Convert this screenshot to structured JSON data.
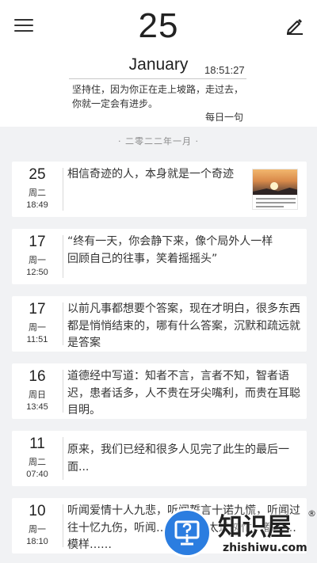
{
  "header": {
    "menu_icon": "hamburger-menu-icon",
    "edit_icon": "pencil-edit-icon",
    "day": "25",
    "month": "January",
    "time": "18:51:27",
    "quote": "坚持住，因为你正在走上坡路，走过去，你就一定会有进步。",
    "quote_label": "每日一句"
  },
  "month_divider": "· 二零二二年一月 ·",
  "entries": [
    {
      "day": "25",
      "weekday": "周二",
      "time": "18:49",
      "text": "相信奇迹的人，本身就是一个奇迹"
    },
    {
      "day": "17",
      "weekday": "周一",
      "time": "12:50",
      "text": "“终有一天，你会静下来，像个局外人一样回顾自己的往事，笑着摇摇头”"
    },
    {
      "day": "17",
      "weekday": "周一",
      "time": "11:51",
      "text": "以前凡事都想要个答案，现在才明白，很多东西都是悄悄结束的，哪有什么答案，沉默和疏远就是答案"
    },
    {
      "day": "16",
      "weekday": "周日",
      "time": "13:45",
      "text": "道德经中写道：知者不言，言者不知，智者语迟，患者话多，人不贵在牙尖嘴利，而贵在耳聪目明。"
    },
    {
      "day": "11",
      "weekday": "周二",
      "time": "07:40",
      "text": "原来，我们已经和很多人见完了此生的最后一面..."
    },
    {
      "day": "10",
      "weekday": "周一",
      "time": "18:10",
      "text": "听闻爱情十人九悲，听闻誓言十诺九慌，听闻过往十忆九伤，听闻… 终… 的太过匆忙，都忘… 模样……"
    }
  ],
  "watermark": {
    "name": "知识屋",
    "reg": "®",
    "url": "zhishiwu.com",
    "icon": "question-mark-monitor-icon"
  }
}
